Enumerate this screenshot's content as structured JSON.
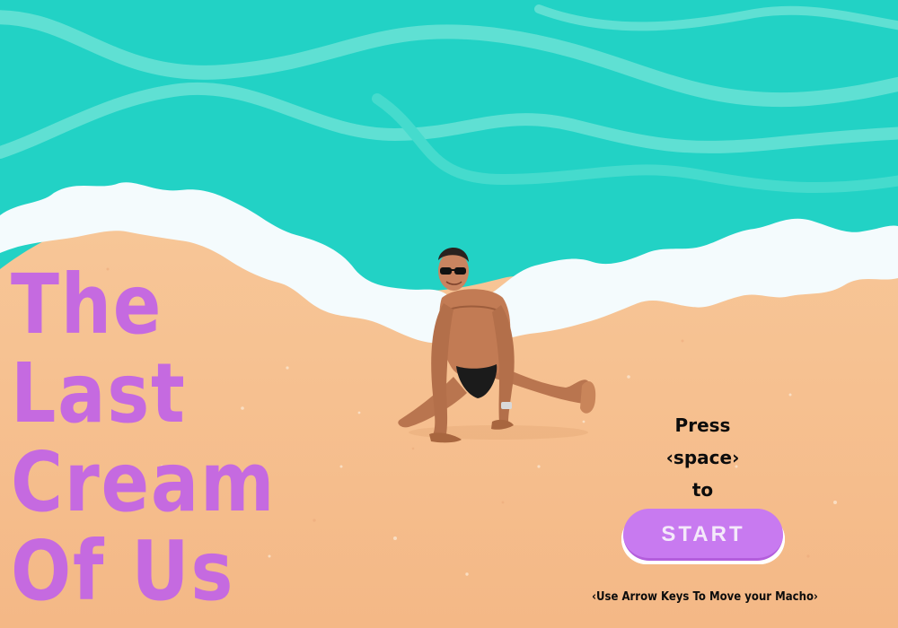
{
  "game": {
    "title_lines": [
      "The",
      "Last",
      "Cream",
      "Of Us"
    ],
    "prompt": {
      "line1": "Press",
      "line2": "‹space›",
      "line3": "to"
    },
    "start_label": "START",
    "controls_hint": "‹Use Arrow Keys To Move your Macho›",
    "colors": {
      "title": "#c56ae0",
      "start_button": "#c87af0",
      "sea": "#24d3c6",
      "foam": "#f4fbfd",
      "sand": "#f6c193"
    }
  }
}
